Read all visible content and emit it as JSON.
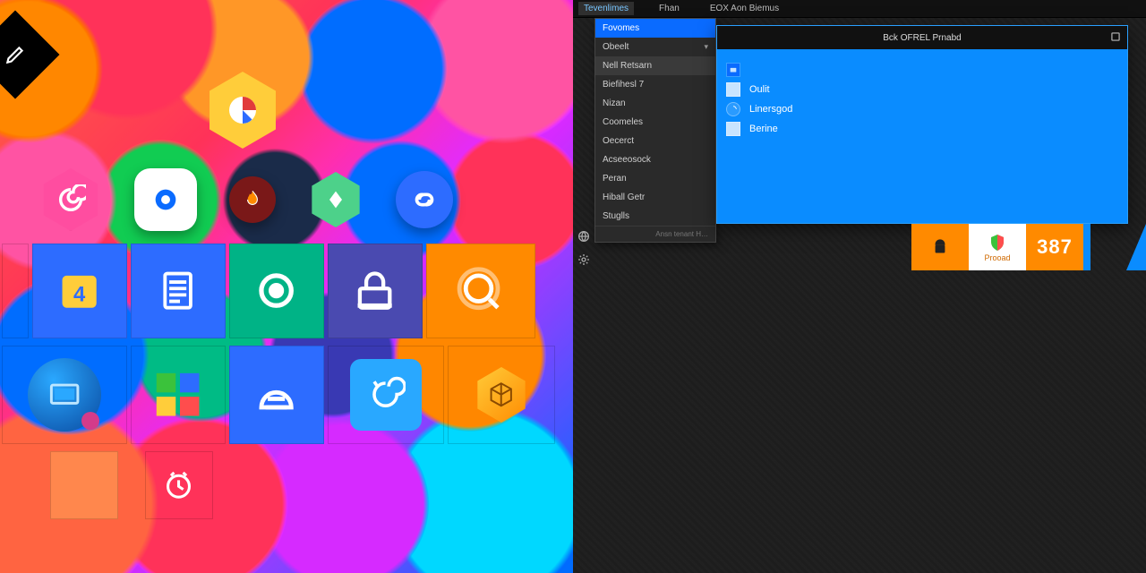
{
  "left": {
    "float_top_icon": "chart",
    "float_row_icons": [
      "spiral",
      "camera",
      "flame",
      "diamond",
      "link"
    ],
    "tiles": {
      "row1": [
        {
          "color": "#ff8a00",
          "icon": "calendar",
          "text": "4"
        },
        {
          "color": "#2d6cff",
          "icon": "document"
        },
        {
          "color": "#00b386",
          "icon": "target"
        },
        {
          "color": "#4a4ab0",
          "icon": "lock"
        },
        {
          "color": "#ff8a00",
          "icon": "search"
        }
      ],
      "row2": [
        {
          "color": "transparent",
          "icon": "monitor"
        },
        {
          "color": "transparent",
          "icon": "windows"
        },
        {
          "color": "#2d6cff",
          "icon": "drive"
        },
        {
          "color": "#29a8ff",
          "icon": "swirl"
        },
        {
          "color": "transparent",
          "icon": "cube"
        }
      ],
      "row3": [
        {
          "color": "transparent",
          "icon": "blank"
        },
        {
          "color": "transparent",
          "icon": "clock"
        }
      ]
    }
  },
  "right": {
    "menubar": {
      "items": [
        "Tevenlimes",
        "Fhan",
        "EOX Aon Biemus"
      ],
      "active_index": 0
    },
    "dropdown": {
      "items": [
        {
          "label": "Fovomes",
          "state": "hl"
        },
        {
          "label": "Obeelt",
          "chevron": true
        },
        {
          "label": "Nell Retsarn",
          "state": "sel"
        },
        {
          "label": "Biefihesl 7"
        },
        {
          "label": "Nizan"
        },
        {
          "label": "Coomeles"
        },
        {
          "label": "Oecerct"
        },
        {
          "label": "Acseeosock"
        },
        {
          "label": "Peran"
        },
        {
          "label": "Hiball Getr"
        },
        {
          "label": "Stuglls"
        }
      ],
      "footer": "Ansn tenant H…"
    },
    "window": {
      "title": "Bck OFREL Prnabd",
      "entries": [
        {
          "icon": "folder",
          "label": ""
        },
        {
          "icon": "item",
          "label": "Oulit"
        },
        {
          "icon": "spinner",
          "label": "Linersgod"
        },
        {
          "icon": "item",
          "label": "Berine"
        }
      ]
    },
    "tray": {
      "box1_label": "",
      "box2_label": "Prooad",
      "box3_label": "387"
    }
  }
}
